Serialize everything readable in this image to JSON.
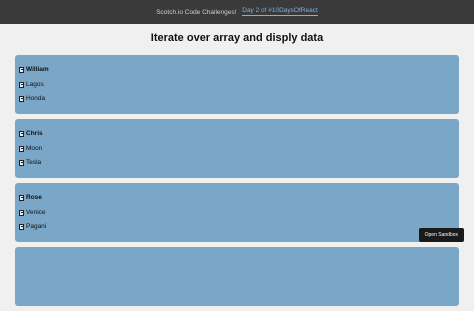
{
  "topbar": {
    "prefix": "Scotch.io Code Challenges!",
    "sep": "",
    "link": "Day 2 of #10DaysOfReact"
  },
  "title": "Iterate over array and disply data",
  "people": [
    {
      "name": "William",
      "items": [
        "Lagos",
        "Honda"
      ]
    },
    {
      "name": "Chris",
      "items": [
        "Moon",
        "Tesla"
      ]
    },
    {
      "name": "Rose",
      "items": [
        "Venice",
        "Pagani"
      ]
    }
  ],
  "sandbox": {
    "label": "Open Sandbox"
  }
}
